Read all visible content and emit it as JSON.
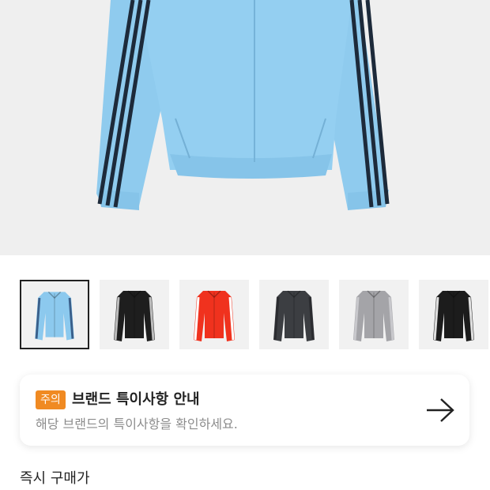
{
  "product": {
    "main_image_icon": "jacket-main-image",
    "thumbnails": [
      {
        "name": "thumbnail-sky-blue",
        "color": "#8cc9ee",
        "accent": "#3a5f8a",
        "selected": true
      },
      {
        "name": "thumbnail-black",
        "color": "#1e1e1e",
        "accent": "#bdbdbd",
        "selected": false
      },
      {
        "name": "thumbnail-red",
        "color": "#f0321e",
        "accent": "#ffffff",
        "selected": false
      },
      {
        "name": "thumbnail-charcoal",
        "color": "#3c3e42",
        "accent": "#2b2c30",
        "selected": false
      },
      {
        "name": "thumbnail-gray",
        "color": "#a4a4a8",
        "accent": "#c8c8cc",
        "selected": false
      },
      {
        "name": "thumbnail-black-white",
        "color": "#1c1c1c",
        "accent": "#e0e0e0",
        "selected": false
      }
    ]
  },
  "notice": {
    "badge": "주의",
    "title": "브랜드 특이사항 안내",
    "description": "해당 브랜드의 특이사항을 확인하세요.",
    "arrow_icon": "arrow-right-icon",
    "badge_color": "#f08a22"
  },
  "purchase": {
    "label": "즉시 구매가"
  }
}
